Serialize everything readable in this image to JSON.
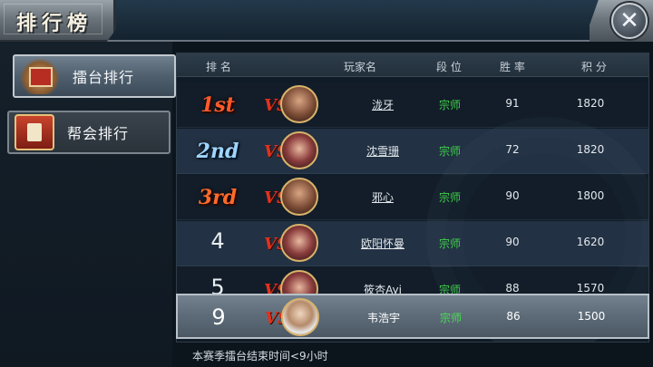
{
  "header": {
    "title": "排行榜",
    "close_label": "✕"
  },
  "tabs": [
    {
      "label": "擂台排行",
      "active": true
    },
    {
      "label": "帮会排行",
      "active": false
    }
  ],
  "columns": {
    "rank": "排 名",
    "player": "玩家名",
    "tier": "段 位",
    "winrate": "胜 率",
    "points": "积 分"
  },
  "rows": [
    {
      "rank": "1st",
      "vs": "VS",
      "name": "泷牙",
      "tier": "宗师",
      "winrate": "91",
      "points": "1820"
    },
    {
      "rank": "2nd",
      "vs": "VS",
      "name": "沈雪珊",
      "tier": "宗师",
      "winrate": "72",
      "points": "1820"
    },
    {
      "rank": "3rd",
      "vs": "VS",
      "name": "邪心",
      "tier": "宗师",
      "winrate": "90",
      "points": "1800"
    },
    {
      "rank": "4",
      "vs": "VS",
      "name": "欧阳怀曼",
      "tier": "宗师",
      "winrate": "90",
      "points": "1620"
    },
    {
      "rank": "5",
      "vs": "VS",
      "name": "筱杏Ayi",
      "tier": "宗师",
      "winrate": "88",
      "points": "1570"
    }
  ],
  "self_row": {
    "rank": "9",
    "vs": "VS",
    "name": "韦浩宇",
    "tier": "宗师",
    "winrate": "86",
    "points": "1500"
  },
  "footer": {
    "note": "本赛季擂台结束时间<9小时"
  }
}
